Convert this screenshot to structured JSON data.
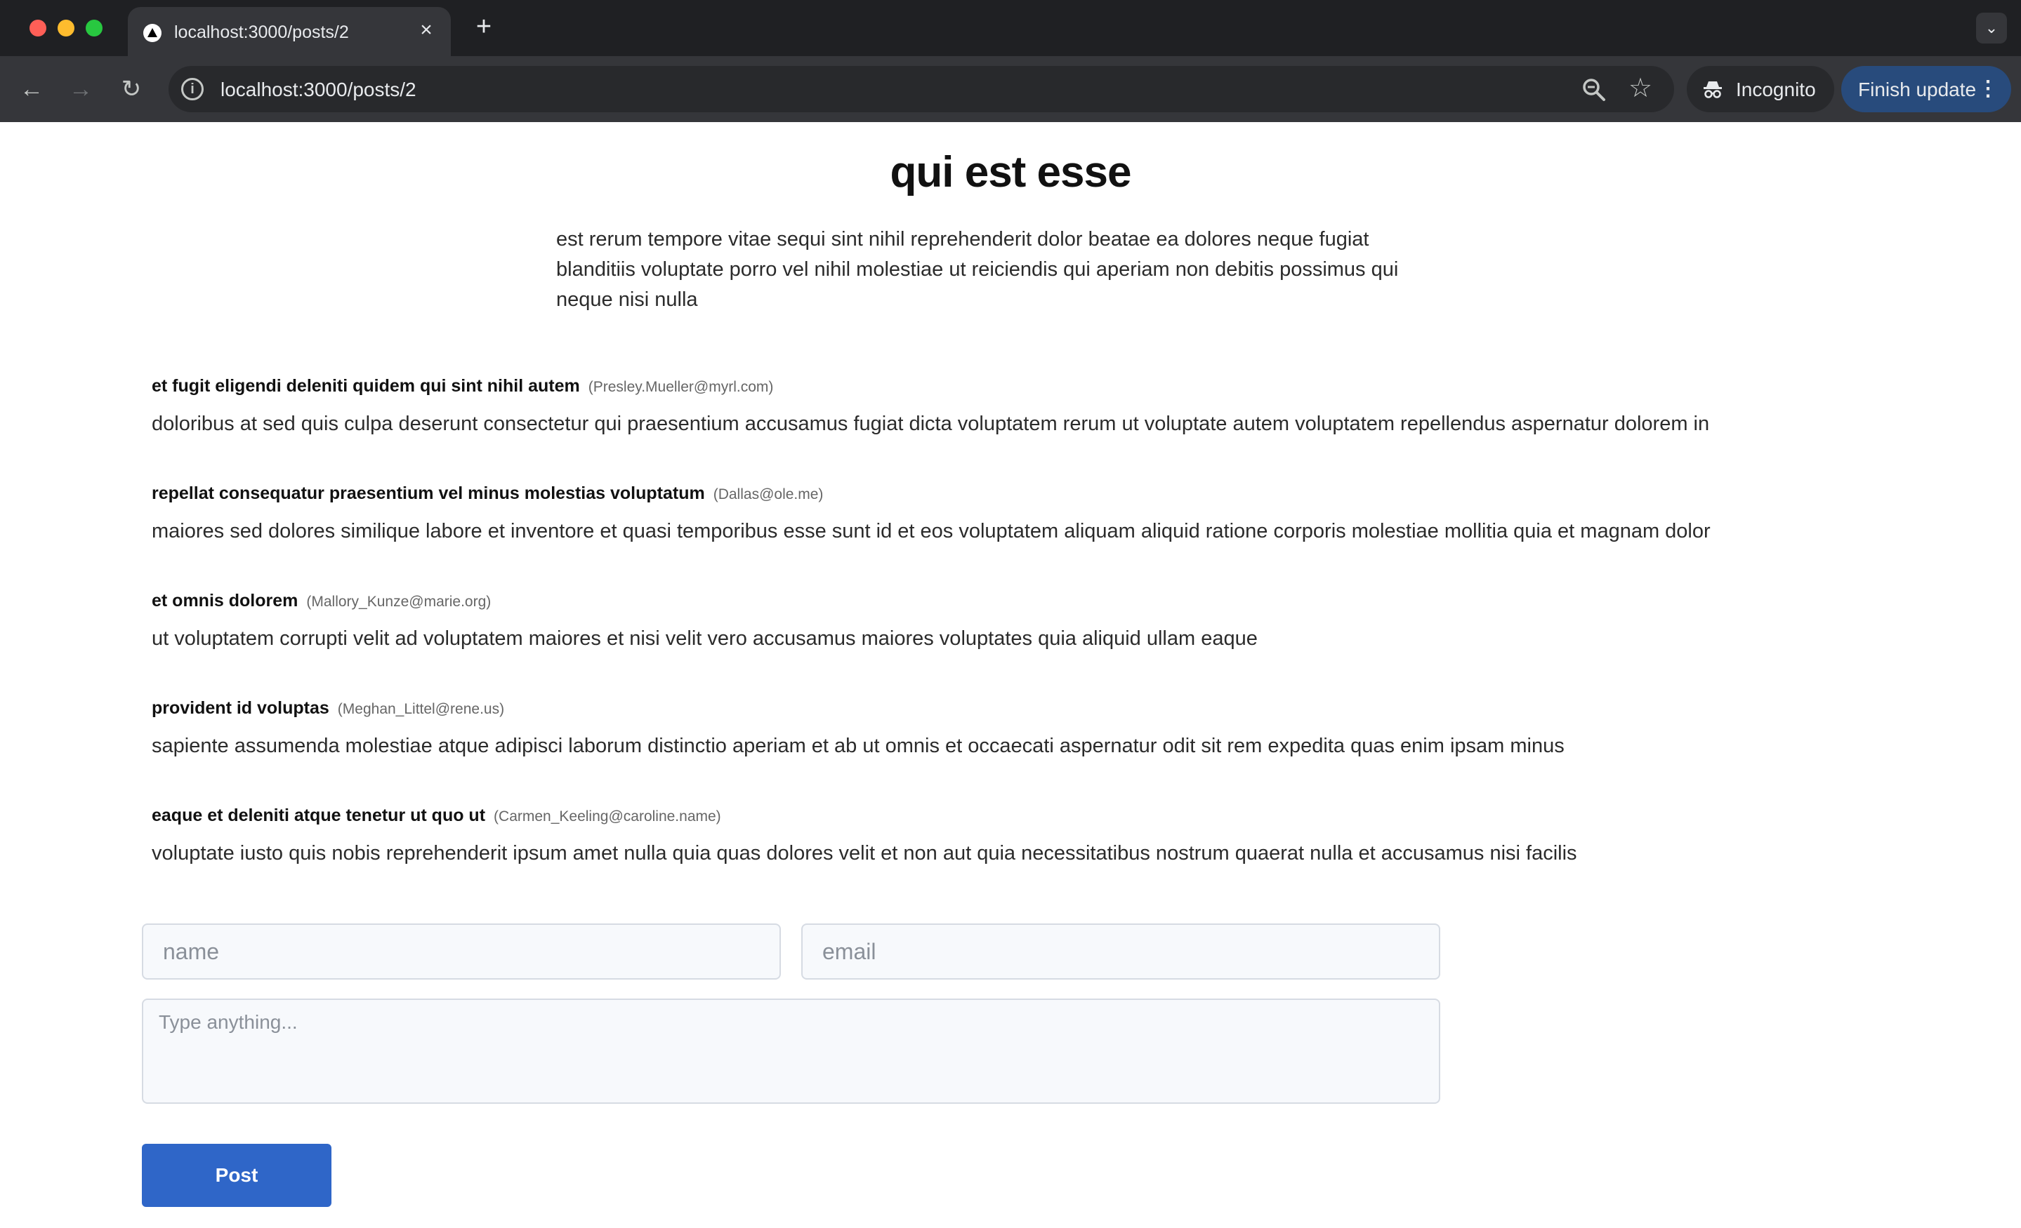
{
  "browser": {
    "tab": {
      "title": "localhost:3000/posts/2",
      "favicon": "triangle-icon",
      "close": "×"
    },
    "new_tab": "+",
    "tab_menu": "⌄",
    "url": "localhost:3000/posts/2",
    "icons": {
      "back": "←",
      "forward": "→",
      "reload": "↻",
      "info": "i",
      "bookmark": "☆",
      "menu": "⋮"
    },
    "incognito_label": "Incognito",
    "update_label": "Finish update"
  },
  "post": {
    "title": "qui est esse",
    "body": "est rerum tempore vitae sequi sint nihil reprehenderit dolor beatae ea dolores neque fugiat blanditiis voluptate porro vel nihil molestiae ut reiciendis qui aperiam non debitis possimus qui neque nisi nulla"
  },
  "comments": [
    {
      "name": "et fugit eligendi deleniti quidem qui sint nihil autem",
      "email": "(Presley.Mueller@myrl.com)",
      "body": "doloribus at sed quis culpa deserunt consectetur qui praesentium accusamus fugiat dicta voluptatem rerum ut voluptate autem voluptatem repellendus aspernatur dolorem in"
    },
    {
      "name": "repellat consequatur praesentium vel minus molestias voluptatum",
      "email": "(Dallas@ole.me)",
      "body": "maiores sed dolores similique labore et inventore et quasi temporibus esse sunt id et eos voluptatem aliquam aliquid ratione corporis molestiae mollitia quia et magnam dolor"
    },
    {
      "name": "et omnis dolorem",
      "email": "(Mallory_Kunze@marie.org)",
      "body": "ut voluptatem corrupti velit ad voluptatem maiores et nisi velit vero accusamus maiores voluptates quia aliquid ullam eaque"
    },
    {
      "name": "provident id voluptas",
      "email": "(Meghan_Littel@rene.us)",
      "body": "sapiente assumenda molestiae atque adipisci laborum distinctio aperiam et ab ut omnis et occaecati aspernatur odit sit rem expedita quas enim ipsam minus"
    },
    {
      "name": "eaque et deleniti atque tenetur ut quo ut",
      "email": "(Carmen_Keeling@caroline.name)",
      "body": "voluptate iusto quis nobis reprehenderit ipsum amet nulla quia quas dolores velit et non aut quia necessitatibus nostrum quaerat nulla et accusamus nisi facilis"
    }
  ],
  "form": {
    "name_placeholder": "name",
    "name_value": "",
    "email_placeholder": "email",
    "email_value": "",
    "message_placeholder": "Type anything...",
    "message_value": "",
    "submit_label": "Post"
  },
  "colors": {
    "chrome_bg": "#1f2023",
    "toolbar_bg": "#35363a",
    "update_pill": "#284b7c",
    "post_button": "#2f66c8",
    "page_bg": "#ffffff"
  }
}
